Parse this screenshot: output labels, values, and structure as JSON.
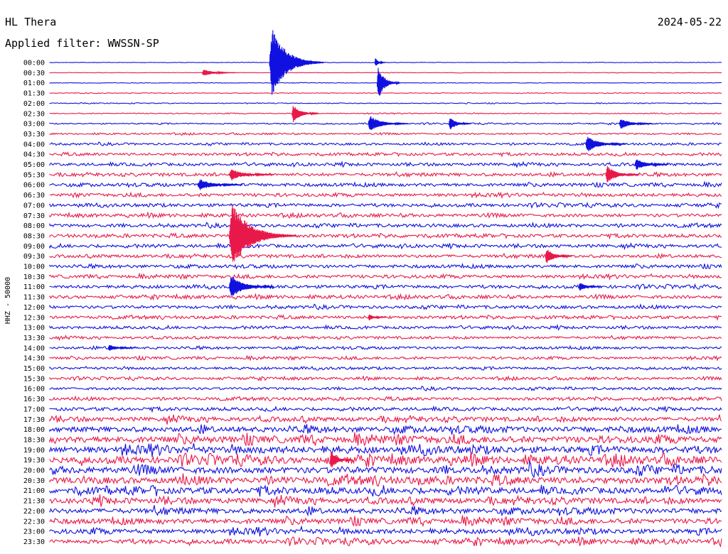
{
  "station": "HL Thera",
  "filter_text": "Applied filter: WWSSN-SP",
  "date": "2024-05-22",
  "chart_data": {
    "type": "helicorder",
    "ylabel": "HHZ - 50000",
    "row_labels": [
      "00:00",
      "00:30",
      "01:00",
      "01:30",
      "02:00",
      "02:30",
      "03:00",
      "03:30",
      "04:00",
      "04:30",
      "05:00",
      "05:30",
      "06:00",
      "06:30",
      "07:00",
      "07:30",
      "08:00",
      "08:30",
      "09:00",
      "09:30",
      "10:00",
      "10:30",
      "11:00",
      "11:30",
      "12:00",
      "12:30",
      "13:00",
      "13:30",
      "14:00",
      "14:30",
      "15:00",
      "15:30",
      "16:00",
      "16:30",
      "17:00",
      "17:30",
      "18:00",
      "18:30",
      "19:00",
      "19:30",
      "20:00",
      "20:30",
      "21:00",
      "21:30",
      "22:00",
      "22:30",
      "23:00",
      "23:30"
    ],
    "trace_colors": [
      "#1010e0",
      "#e8194a"
    ],
    "minutes_per_row": 30,
    "noise_level": [
      0.3,
      0.3,
      0.3,
      0.4,
      0.5,
      0.6,
      0.8,
      1.0,
      1.3,
      1.6,
      1.8,
      2.0,
      2.0,
      2.0,
      2.0,
      2.0,
      2.0,
      2.0,
      2.0,
      2.0,
      2.0,
      2.0,
      2.0,
      2.0,
      1.9,
      1.8,
      1.7,
      1.6,
      1.6,
      1.6,
      1.6,
      1.6,
      1.6,
      1.8,
      2.0,
      2.6,
      3.4,
      3.8,
      4.0,
      4.0,
      4.0,
      3.8,
      3.6,
      3.3,
      3.2,
      3.0,
      2.8,
      2.6
    ],
    "events": [
      {
        "row": 0,
        "minute": 9.8,
        "amplitude": 60,
        "duration": 2.4
      },
      {
        "row": 0,
        "minute": 14.5,
        "amplitude": 8,
        "duration": 0.5
      },
      {
        "row": 1,
        "minute": 6.8,
        "amplitude": 6,
        "duration": 1.5
      },
      {
        "row": 2,
        "minute": 14.6,
        "amplitude": 30,
        "duration": 1.0
      },
      {
        "row": 5,
        "minute": 10.8,
        "amplitude": 16,
        "duration": 1.2
      },
      {
        "row": 6,
        "minute": 14.2,
        "amplitude": 14,
        "duration": 1.8
      },
      {
        "row": 6,
        "minute": 17.8,
        "amplitude": 12,
        "duration": 1.0
      },
      {
        "row": 6,
        "minute": 25.4,
        "amplitude": 10,
        "duration": 1.5
      },
      {
        "row": 8,
        "minute": 23.9,
        "amplitude": 14,
        "duration": 1.8
      },
      {
        "row": 10,
        "minute": 26.1,
        "amplitude": 10,
        "duration": 1.5
      },
      {
        "row": 11,
        "minute": 8.0,
        "amplitude": 10,
        "duration": 2.0
      },
      {
        "row": 11,
        "minute": 24.8,
        "amplitude": 15,
        "duration": 1.5
      },
      {
        "row": 12,
        "minute": 6.6,
        "amplitude": 10,
        "duration": 2.0
      },
      {
        "row": 17,
        "minute": 8.0,
        "amplitude": 55,
        "duration": 3.0
      },
      {
        "row": 19,
        "minute": 22.1,
        "amplitude": 14,
        "duration": 1.2
      },
      {
        "row": 22,
        "minute": 8.0,
        "amplitude": 20,
        "duration": 2.0
      },
      {
        "row": 22,
        "minute": 23.6,
        "amplitude": 8,
        "duration": 1.0
      },
      {
        "row": 25,
        "minute": 14.2,
        "amplitude": 6,
        "duration": 0.8
      },
      {
        "row": 28,
        "minute": 2.6,
        "amplitude": 6,
        "duration": 1.2
      },
      {
        "row": 39,
        "minute": 12.5,
        "amplitude": 16,
        "duration": 1.0
      }
    ]
  }
}
